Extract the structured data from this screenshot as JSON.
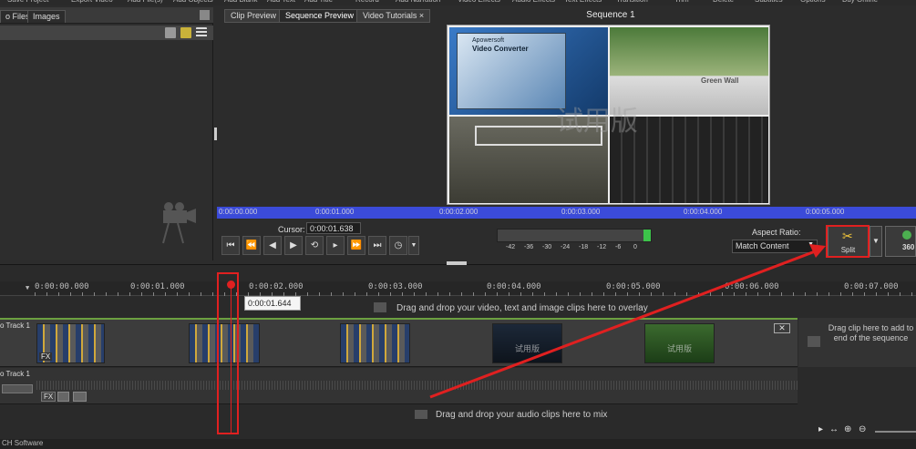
{
  "toolbar": {
    "items": [
      "Save Project",
      "Export Video",
      "Add File(s)",
      "Add Objects",
      "Add Blank",
      "Add Text",
      "Add Title",
      "Record",
      "Add Narration",
      "Video Effects",
      "Audio Effects",
      "Text Effects",
      "Transition",
      "Trim",
      "Delete",
      "Subtitles",
      "Options",
      "Buy Online"
    ]
  },
  "media": {
    "tab_files": "o Files",
    "tab_images": "Images"
  },
  "preview": {
    "tabs": [
      "Clip Preview",
      "Sequence Preview",
      "Video Tutorials"
    ],
    "tab_close": "×",
    "sequence_title": "Sequence 1",
    "clip_logo_brand": "Apowersoft",
    "clip_logo_title": "Video Converter",
    "clip_label_green": "Green Wall",
    "watermark": "试用版",
    "ruler_times": [
      "0:00:00.000",
      "0:00:01.000",
      "0:00:02.000",
      "0:00:03.000",
      "0:00:04.000",
      "0:00:05.000"
    ],
    "cursor_label": "Cursor:",
    "cursor_value": "0:00:01.638",
    "meter_labels": [
      "-42",
      "-36",
      "-30",
      "-24",
      "-18",
      "-12",
      "-6",
      "0"
    ],
    "aspect_label": "Aspect Ratio:",
    "aspect_value": "Match Content",
    "split_label": "Split",
    "btn_360_label": "360"
  },
  "timeline": {
    "ruler_times": [
      "0:00:00.000",
      "0:00:01.000",
      "0:00:02.000",
      "0:00:03.000",
      "0:00:04.000",
      "0:00:05.000",
      "0:00:06.000",
      "0:00:07.000"
    ],
    "tooltip_time": "0:00:01.644",
    "overlay_hint": "Drag and drop your video, text and image clips here to overlay",
    "video_track_label": "o Track 1",
    "clip_fx": "FX",
    "clip_watermark": "试用版",
    "drag_end_hint": "Drag clip here to add to end of the sequence",
    "audio_track_label": "o Track 1",
    "audio_hint": "Drag and drop your audio clips here to mix"
  },
  "status": {
    "software": "CH Software"
  },
  "colors": {
    "accent_red": "#e02020",
    "ruler_blue": "#3b4bd9",
    "meter_green": "#3cc34a"
  }
}
